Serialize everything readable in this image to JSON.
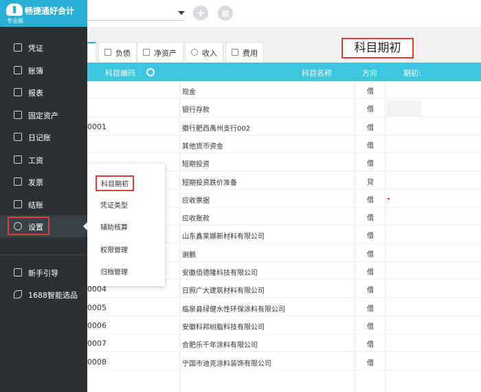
{
  "app": {
    "name": "畅捷通好会计",
    "edition": "专业版"
  },
  "sidebar": {
    "items": [
      {
        "label": "凭证",
        "icon": "voucher-icon"
      },
      {
        "label": "账簿",
        "icon": "ledger-icon"
      },
      {
        "label": "报表",
        "icon": "report-icon"
      },
      {
        "label": "固定资产",
        "icon": "asset-icon"
      },
      {
        "label": "日记账",
        "icon": "journal-icon"
      },
      {
        "label": "工资",
        "icon": "salary-icon"
      },
      {
        "label": "发票",
        "icon": "invoice-icon"
      },
      {
        "label": "结账",
        "icon": "close-account-icon"
      },
      {
        "label": "设置",
        "icon": "settings-icon",
        "active": true
      }
    ],
    "extra": [
      {
        "label": "新手引导",
        "icon": "guide-icon"
      },
      {
        "label": "1688智能选品",
        "icon": "link-icon"
      }
    ]
  },
  "topbar": {
    "add_symbol": "+",
    "grid_symbol": "▦"
  },
  "tabs": [
    {
      "label": "负债"
    },
    {
      "label": "净资产"
    },
    {
      "label": "收入"
    },
    {
      "label": "费用"
    }
  ],
  "page_title": "科目期初",
  "table": {
    "headers": {
      "code": "科目编码",
      "name": "科目名称",
      "direction": "方向",
      "initial": "期初:"
    },
    "rows": [
      {
        "code": "",
        "name": "现金",
        "dir": "借"
      },
      {
        "code": "",
        "name": "银行存款",
        "dir": "借"
      },
      {
        "code": "0001",
        "name": "徽行肥西禹州支行002",
        "dir": "借"
      },
      {
        "code": "",
        "name": "其他货币资金",
        "dir": "借"
      },
      {
        "code": "",
        "name": "短期投资",
        "dir": "借"
      },
      {
        "code": "",
        "name": "短期投资跌价准备",
        "dir": "贷"
      },
      {
        "code": "",
        "name": "应收票据",
        "dir": "借"
      },
      {
        "code": "",
        "name": "应收账款",
        "dir": "借"
      },
      {
        "code": "",
        "name": "山东鑫莱娜新材料有限公司",
        "dir": "借"
      },
      {
        "code": "",
        "name": "谢鹏",
        "dir": "借"
      },
      {
        "code": "",
        "name": "安徽佰德隆科技有限公司",
        "dir": "借"
      },
      {
        "code": "0004",
        "name": "日照广大建筑材料有限公司",
        "dir": "借"
      },
      {
        "code": "0005",
        "name": "临泉县绿健水性环保涂料有限公司",
        "dir": "借"
      },
      {
        "code": "0006",
        "name": "安徽科邦树脂科技有限公司",
        "dir": "借"
      },
      {
        "code": "0007",
        "name": "合肥乐千年涂料有限公司",
        "dir": "借"
      },
      {
        "code": "0008",
        "name": "宁国市迪克涂料装饰有限公司",
        "dir": "借"
      }
    ]
  },
  "submenu": {
    "items": [
      {
        "label": "科目期初",
        "selected": true
      },
      {
        "label": "凭证类型"
      },
      {
        "label": "辅助核算"
      },
      {
        "label": "权限管理"
      },
      {
        "label": "归档管理"
      }
    ]
  }
}
